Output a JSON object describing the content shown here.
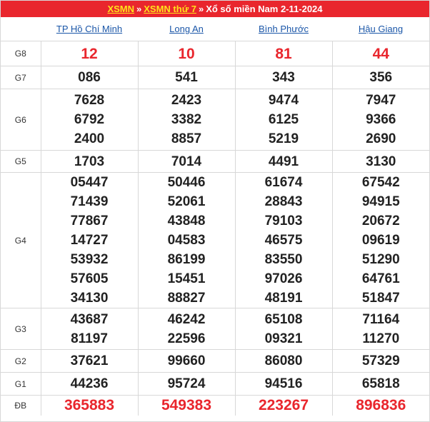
{
  "breadcrumb": {
    "link1": "XSMN",
    "sep1": "»",
    "link2": "XSMN thứ 7",
    "sep2": "»",
    "title": "Xổ số miền Nam 2-11-2024"
  },
  "provinces": [
    "TP Hồ Chí Minh",
    "Long An",
    "Bình Phước",
    "Hậu Giang"
  ],
  "prizes": [
    {
      "label": "G8",
      "values": [
        [
          "12"
        ],
        [
          "10"
        ],
        [
          "81"
        ],
        [
          "44"
        ]
      ]
    },
    {
      "label": "G7",
      "values": [
        [
          "086"
        ],
        [
          "541"
        ],
        [
          "343"
        ],
        [
          "356"
        ]
      ]
    },
    {
      "label": "G6",
      "values": [
        [
          "7628",
          "6792",
          "2400"
        ],
        [
          "2423",
          "3382",
          "8857"
        ],
        [
          "9474",
          "6125",
          "5219"
        ],
        [
          "7947",
          "9366",
          "2690"
        ]
      ]
    },
    {
      "label": "G5",
      "values": [
        [
          "1703"
        ],
        [
          "7014"
        ],
        [
          "4491"
        ],
        [
          "3130"
        ]
      ]
    },
    {
      "label": "G4",
      "values": [
        [
          "05447",
          "71439",
          "77867",
          "14727",
          "53932",
          "57605",
          "34130"
        ],
        [
          "50446",
          "52061",
          "43848",
          "04583",
          "86199",
          "15451",
          "88827"
        ],
        [
          "61674",
          "28843",
          "79103",
          "46575",
          "83550",
          "97026",
          "48191"
        ],
        [
          "67542",
          "94915",
          "20672",
          "09619",
          "51290",
          "64761",
          "51847"
        ]
      ]
    },
    {
      "label": "G3",
      "values": [
        [
          "43687",
          "81197"
        ],
        [
          "46242",
          "22596"
        ],
        [
          "65108",
          "09321"
        ],
        [
          "71164",
          "11270"
        ]
      ]
    },
    {
      "label": "G2",
      "values": [
        [
          "37621"
        ],
        [
          "99660"
        ],
        [
          "86080"
        ],
        [
          "57329"
        ]
      ]
    },
    {
      "label": "G1",
      "values": [
        [
          "44236"
        ],
        [
          "95724"
        ],
        [
          "94516"
        ],
        [
          "65818"
        ]
      ]
    },
    {
      "label": "ĐB",
      "values": [
        [
          "365883"
        ],
        [
          "549383"
        ],
        [
          "223267"
        ],
        [
          "896836"
        ]
      ]
    }
  ],
  "colors": {
    "accent_red": "#e9262d",
    "link_blue": "#1a56a8",
    "crumb_yellow": "#ffe21a"
  }
}
